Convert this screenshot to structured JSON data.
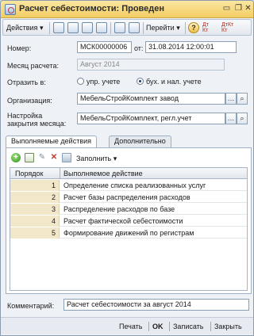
{
  "window": {
    "title": "Расчет себестоимости: Проведен"
  },
  "toolbar": {
    "actions_label": "Действия",
    "goto_label": "Перейти",
    "dt_label": "Дт",
    "kt_label": "Кт",
    "dt_kt_label": "ДтКт"
  },
  "fields": {
    "number_label": "Номер:",
    "number_value": "МСК00000006",
    "from_label": "от:",
    "date_value": "31.08.2014 12:00:01",
    "month_label": "Месяц расчета:",
    "month_value": "Август 2014",
    "reflect_label": "Отразить в:",
    "radio_mgmt_label": "упр. учете",
    "radio_acc_label": "бух. и нал. учете",
    "org_label": "Организация:",
    "org_value": "МебельСтройКомплект завод",
    "setup_label_line1": "Настройка",
    "setup_label_line2": "закрытия месяца:",
    "setup_value": "МебельСтройКомплект, регл.учет",
    "comment_label": "Комментарий:",
    "comment_value": "Расчет себестоимости за август 2014"
  },
  "tabs": [
    {
      "label": "Выполняемые действия",
      "active": true
    },
    {
      "label": "Дополнительно",
      "active": false
    }
  ],
  "panel_toolbar": {
    "fill_label": "Заполнить"
  },
  "table": {
    "headers": [
      "Порядок",
      "Выполняемое действие"
    ],
    "rows": [
      {
        "order": "1",
        "action": "Определение списка реализованных услуг"
      },
      {
        "order": "2",
        "action": "Расчет базы распределения расходов"
      },
      {
        "order": "3",
        "action": "Распределение расходов по базе"
      },
      {
        "order": "4",
        "action": "Расчет фактической себестоимости"
      },
      {
        "order": "5",
        "action": "Формирование движений по регистрам"
      }
    ]
  },
  "buttons": {
    "print": "Печать",
    "ok": "OK",
    "save": "Записать",
    "close": "Закрыть"
  },
  "colors": {
    "title_bar": "#f3cd63",
    "order_cell": "#f2e7c9",
    "selection": "#c8d8ee"
  }
}
